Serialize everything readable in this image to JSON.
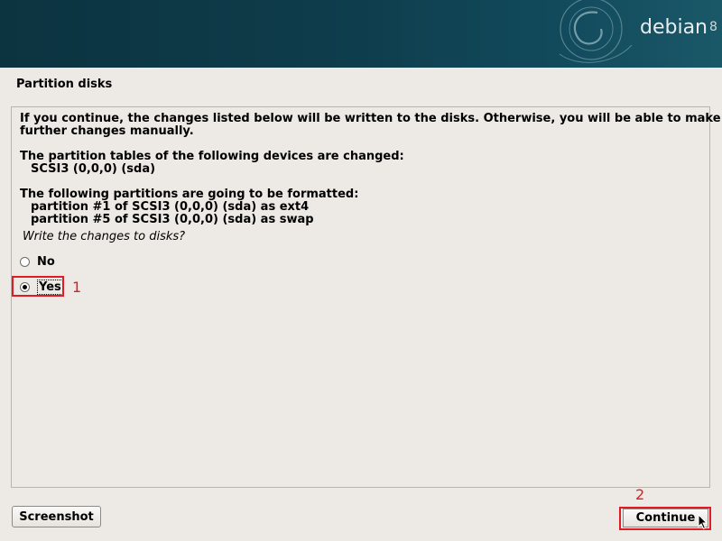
{
  "header": {
    "brand": "debian",
    "version": "8"
  },
  "page_title": "Partition disks",
  "body": {
    "intro_line1": "If you continue, the changes listed below will be written to the disks. Otherwise, you will be able to make",
    "intro_line2": "further changes manually.",
    "tables_heading": "The partition tables of the following devices are changed:",
    "tables_devices": [
      "SCSI3 (0,0,0) (sda)"
    ],
    "format_heading": "The following partitions are going to be formatted:",
    "format_partitions": [
      "partition #1 of SCSI3 (0,0,0) (sda) as ext4",
      "partition #5 of SCSI3 (0,0,0) (sda) as swap"
    ],
    "question": "Write the changes to disks?"
  },
  "options": [
    {
      "label": "No",
      "selected": false
    },
    {
      "label": "Yes",
      "selected": true
    }
  ],
  "buttons": {
    "screenshot": "Screenshot",
    "continue": "Continue"
  },
  "annotations": {
    "step1": "1",
    "step2": "2",
    "color": "#e01b24"
  },
  "colors": {
    "banner": "#0e3c4b",
    "background": "#edeae5",
    "annotation": "#e01b24"
  }
}
